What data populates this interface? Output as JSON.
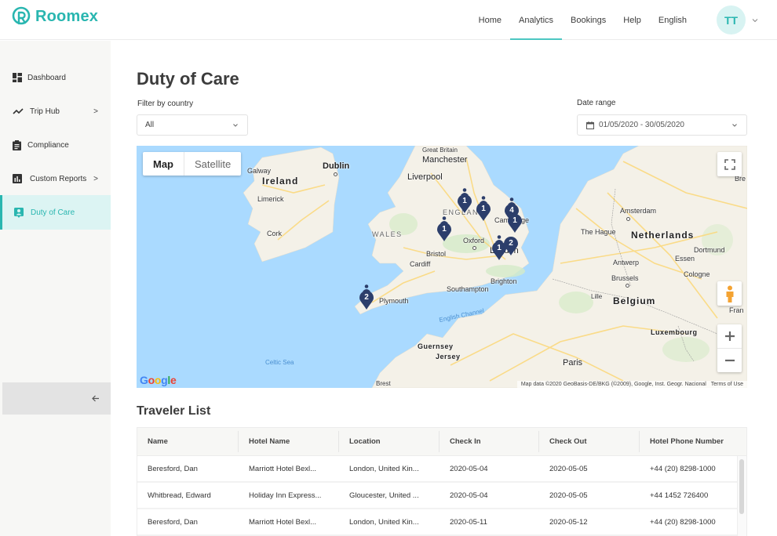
{
  "app": {
    "brand": "Roomex",
    "accent_color": "#29b6b0"
  },
  "header": {
    "nav": [
      {
        "label": "Home",
        "active": false
      },
      {
        "label": "Analytics",
        "active": true
      },
      {
        "label": "Bookings",
        "active": false
      },
      {
        "label": "Help",
        "active": false
      },
      {
        "label": "English",
        "active": false
      }
    ],
    "avatar_initials": "TT"
  },
  "sidebar": {
    "items": [
      {
        "label": "Dashboard",
        "icon": "dashboard-icon",
        "has_submenu": false,
        "active": false
      },
      {
        "label": "Trip Hub",
        "icon": "trend-line-icon",
        "has_submenu": true,
        "active": false
      },
      {
        "label": "Compliance",
        "icon": "clipboard-icon",
        "has_submenu": false,
        "active": false
      },
      {
        "label": "Custom Reports",
        "icon": "bar-chart-icon",
        "has_submenu": true,
        "active": false
      },
      {
        "label": "Duty of Care",
        "icon": "person-badge-icon",
        "has_submenu": false,
        "active": true
      }
    ],
    "chevron": ">",
    "collapse_icon": "arrow-left-icon"
  },
  "page": {
    "title": "Duty of Care",
    "filter_country": {
      "label": "Filter by country",
      "value": "All"
    },
    "date_range": {
      "label": "Date range",
      "value": "01/05/2020 - 30/05/2020"
    }
  },
  "map": {
    "type_buttons": {
      "map": "Map",
      "satellite": "Satellite",
      "selected": "Map"
    },
    "places": {
      "great_britain": "Great Britain",
      "manchester": "Manchester",
      "liverpool": "Liverpool",
      "dublin": "Dublin",
      "galway": "Galway",
      "ireland": "Ireland",
      "limerick": "Limerick",
      "cork": "Cork",
      "wales": "WALES",
      "england": "ENGLAND",
      "cambridge": "Cambridge",
      "oxford": "Oxford",
      "bristol": "Bristol",
      "cardiff": "Cardiff",
      "london": "London",
      "brighton": "Brighton",
      "southampton": "Southampton",
      "plymouth": "Plymouth",
      "english_channel": "English Channel",
      "celtic_sea": "Celtic Sea",
      "guernsey": "Guernsey",
      "jersey": "Jersey",
      "brest": "Brest",
      "paris": "Paris",
      "amsterdam": "Amsterdam",
      "the_hague": "The Hague",
      "netherlands": "Netherlands",
      "dortmund": "Dortmund",
      "essen": "Essen",
      "antwerp": "Antwerp",
      "cologne": "Cologne",
      "brussels": "Brussels",
      "belgium": "Belgium",
      "lille": "Lille",
      "luxembourg": "Luxembourg",
      "bremen_partial": "Bre",
      "france_partial": "Fran"
    },
    "markers": [
      {
        "count": "1",
        "near": "Birmingham"
      },
      {
        "count": "1",
        "near": "Leicester"
      },
      {
        "count": "4",
        "near": "Cambridge north"
      },
      {
        "count": "1",
        "near": "Cambridge"
      },
      {
        "count": "1",
        "near": "Gloucester"
      },
      {
        "count": "1",
        "near": "London west"
      },
      {
        "count": "2",
        "near": "London east"
      },
      {
        "count": "2",
        "near": "Cornwall"
      }
    ],
    "marker_color": "#2c3e6b",
    "google_logo": "Google",
    "attribution": "Map data ©2020 GeoBasis-DE/BKG (©2009), Google, Inst. Geogr. Nacional",
    "terms": "Terms of Use"
  },
  "traveler_list": {
    "title": "Traveler List",
    "columns": [
      "Name",
      "Hotel Name",
      "Location",
      "Check In",
      "Check Out",
      "Hotel Phone Number"
    ],
    "rows": [
      [
        "Beresford, Dan",
        "Marriott Hotel Bexl...",
        "London, United Kin...",
        "2020-05-04",
        "2020-05-05",
        "+44 (20) 8298-1000"
      ],
      [
        "Whitbread, Edward",
        "Holiday Inn Express...",
        "Gloucester, United ...",
        "2020-05-04",
        "2020-05-05",
        "+44 1452 726400"
      ],
      [
        "Beresford, Dan",
        "Marriott Hotel Bexl...",
        "London, United Kin...",
        "2020-05-11",
        "2020-05-12",
        "+44 (20) 8298-1000"
      ]
    ]
  }
}
